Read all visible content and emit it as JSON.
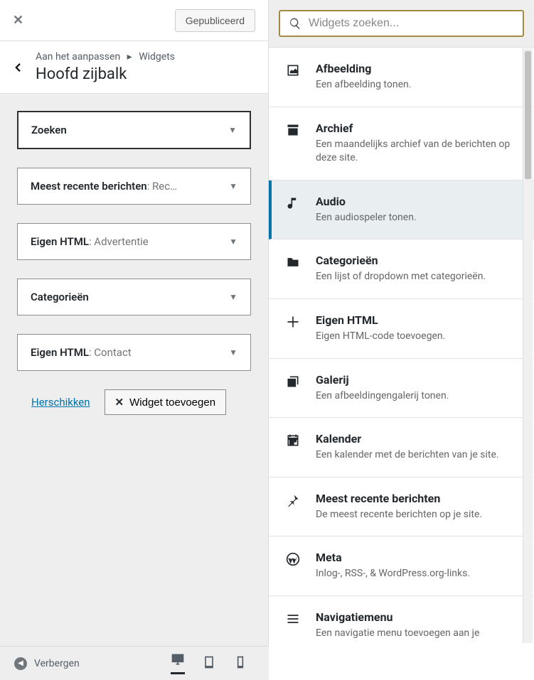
{
  "top": {
    "publish_label": "Gepubliceerd"
  },
  "header": {
    "breadcrumb_root": "Aan het aanpassen",
    "breadcrumb_current": "Widgets",
    "title": "Hoofd zijbalk"
  },
  "widgets": [
    {
      "label": "Zoeken",
      "sub": ""
    },
    {
      "label": "Meest recente berichten",
      "sub": ": Rec…"
    },
    {
      "label": "Eigen HTML",
      "sub": ": Advertentie"
    },
    {
      "label": "Categorieën",
      "sub": ""
    },
    {
      "label": "Eigen HTML",
      "sub": ": Contact"
    }
  ],
  "actions": {
    "reorder_label": "Herschikken",
    "add_label": "Widget toevoegen"
  },
  "search": {
    "placeholder": "Widgets zoeken..."
  },
  "available": [
    {
      "icon": "image",
      "name": "Afbeelding",
      "desc": "Een afbeelding tonen.",
      "selected": false
    },
    {
      "icon": "archive",
      "name": "Archief",
      "desc": "Een maandelijks archief van de berichten op deze site.",
      "selected": false
    },
    {
      "icon": "audio",
      "name": "Audio",
      "desc": "Een audiospeler tonen.",
      "selected": true
    },
    {
      "icon": "folder",
      "name": "Categorieën",
      "desc": "Een lijst of dropdown met categorieën.",
      "selected": false
    },
    {
      "icon": "plus",
      "name": "Eigen HTML",
      "desc": "Eigen HTML-code toevoegen.",
      "selected": false
    },
    {
      "icon": "gallery",
      "name": "Galerij",
      "desc": "Een afbeeldingengalerij tonen.",
      "selected": false
    },
    {
      "icon": "calendar",
      "name": "Kalender",
      "desc": "Een kalender met de berichten van je site.",
      "selected": false
    },
    {
      "icon": "pin",
      "name": "Meest recente berichten",
      "desc": "De meest recente berichten op je site.",
      "selected": false
    },
    {
      "icon": "wordpress",
      "name": "Meta",
      "desc": "Inlog-, RSS-, & WordPress.org-links.",
      "selected": false
    },
    {
      "icon": "menu",
      "name": "Navigatiemenu",
      "desc": "Een navigatie menu toevoegen aan je",
      "selected": false
    }
  ],
  "footer": {
    "hide_label": "Verbergen"
  }
}
